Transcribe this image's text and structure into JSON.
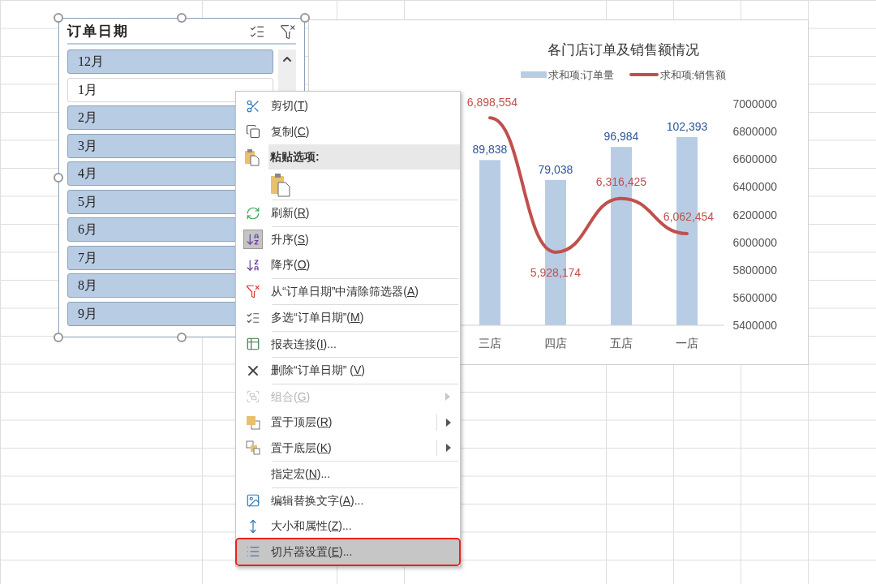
{
  "slicer": {
    "title": "订单日期",
    "items": [
      {
        "label": "12月",
        "selected": true
      },
      {
        "label": "1月",
        "selected": false
      },
      {
        "label": "2月",
        "selected": true
      },
      {
        "label": "3月",
        "selected": true
      },
      {
        "label": "4月",
        "selected": true
      },
      {
        "label": "5月",
        "selected": true
      },
      {
        "label": "6月",
        "selected": true
      },
      {
        "label": "7月",
        "selected": true
      },
      {
        "label": "8月",
        "selected": true
      },
      {
        "label": "9月",
        "selected": true
      }
    ]
  },
  "chart": {
    "title": "各门店订单及销售额情况",
    "bar_series": {
      "name": "求和项:订单量",
      "color": "#b8cce4",
      "labels": [
        "89,838",
        "79,038",
        "96,984",
        "102,393"
      ]
    },
    "chart_data": {
      "type": "line",
      "categories": [
        "三店",
        "四店",
        "五店",
        "一店"
      ],
      "series": [
        {
          "name": "求和项:销售额",
          "color": "#c0504d",
          "values": [
            6898554,
            5928174,
            6316425,
            6062454
          ],
          "value_labels": [
            "6,898,554",
            "5,928,174",
            "6,316,425",
            "6,062,454"
          ]
        }
      ],
      "ylim": [
        5400000,
        7000000
      ],
      "yticks": [
        5400000,
        5600000,
        5800000,
        6000000,
        6200000,
        6400000,
        6600000,
        6800000,
        7000000
      ]
    }
  },
  "context_menu": {
    "items": [
      {
        "kind": "item",
        "label": "剪切(T)",
        "disabled": false,
        "submenu": false,
        "selected": false
      },
      {
        "kind": "item",
        "label": "复制(C)",
        "disabled": false,
        "submenu": false,
        "selected": false
      },
      {
        "kind": "header",
        "label": "粘贴选项:"
      },
      {
        "kind": "paste"
      },
      {
        "kind": "separator"
      },
      {
        "kind": "item",
        "label": "刷新(R)",
        "disabled": false,
        "submenu": false,
        "selected": false
      },
      {
        "kind": "separator"
      },
      {
        "kind": "item",
        "label": "升序(S)",
        "disabled": false,
        "submenu": false,
        "selected": false
      },
      {
        "kind": "item",
        "label": "降序(O)",
        "disabled": false,
        "submenu": false,
        "selected": false
      },
      {
        "kind": "separator"
      },
      {
        "kind": "item",
        "label": "从“订单日期”中清除筛选器(A)",
        "disabled": false,
        "submenu": false,
        "selected": false
      },
      {
        "kind": "separator"
      },
      {
        "kind": "item",
        "label": "多选“订单日期”(M)",
        "disabled": false,
        "submenu": false,
        "selected": false
      },
      {
        "kind": "separator"
      },
      {
        "kind": "item",
        "label": "报表连接(I)...",
        "disabled": false,
        "submenu": false,
        "selected": false
      },
      {
        "kind": "separator"
      },
      {
        "kind": "item",
        "label": "删除“订单日期” (V)",
        "disabled": false,
        "submenu": false,
        "selected": false
      },
      {
        "kind": "separator"
      },
      {
        "kind": "item",
        "label": "组合(G)",
        "disabled": true,
        "submenu": true,
        "selected": false
      },
      {
        "kind": "item",
        "label": "置于顶层(R)",
        "disabled": false,
        "submenu": true,
        "selected": false
      },
      {
        "kind": "item",
        "label": "置于底层(K)",
        "disabled": false,
        "submenu": true,
        "selected": false
      },
      {
        "kind": "separator"
      },
      {
        "kind": "item",
        "label": "指定宏(N)...",
        "disabled": false,
        "submenu": false,
        "selected": false
      },
      {
        "kind": "separator"
      },
      {
        "kind": "item",
        "label": "编辑替换文字(A)...",
        "disabled": false,
        "submenu": false,
        "selected": false
      },
      {
        "kind": "item",
        "label": "大小和属性(Z)...",
        "disabled": false,
        "submenu": false,
        "selected": false
      },
      {
        "kind": "item",
        "label": "切片器设置(E)...",
        "disabled": false,
        "submenu": false,
        "selected": true
      }
    ]
  }
}
